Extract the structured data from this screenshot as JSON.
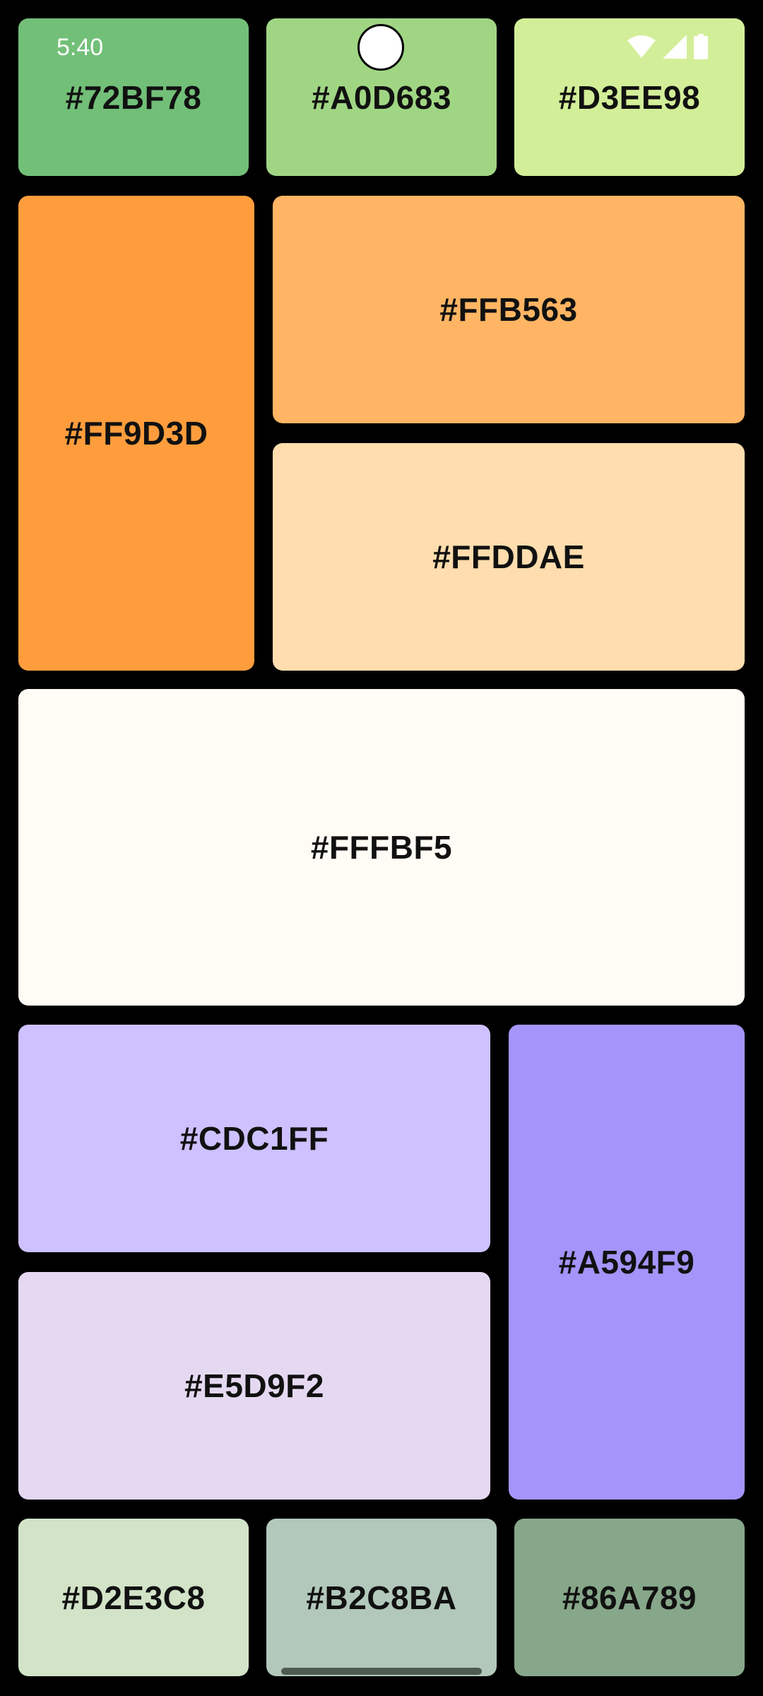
{
  "status_bar": {
    "time": "5:40",
    "icons": [
      "wifi-icon",
      "cell-signal-icon",
      "battery-icon"
    ]
  },
  "tiles": {
    "green_1": {
      "label": "#72BF78",
      "color": "#72BF78"
    },
    "green_2": {
      "label": "#A0D683",
      "color": "#A0D683"
    },
    "green_3": {
      "label": "#D3EE98",
      "color": "#D3EE98"
    },
    "orange_1": {
      "label": "#FF9D3D",
      "color": "#FF9D3D"
    },
    "orange_2": {
      "label": "#FFB563",
      "color": "#FFB563"
    },
    "orange_3": {
      "label": "#FFDDAE",
      "color": "#FFDDAE"
    },
    "cream": {
      "label": "#FFFBF5",
      "color": "#FFFBF5"
    },
    "lavender_1": {
      "label": "#CDC1FF",
      "color": "#CDC1FF"
    },
    "lavender_2": {
      "label": "#E5D9F2",
      "color": "#E5D9F2"
    },
    "purple": {
      "label": "#A594F9",
      "color": "#A594F9"
    },
    "sage_1": {
      "label": "#D2E3C8",
      "color": "#D2E3C8"
    },
    "sage_2": {
      "label": "#B2C8BA",
      "color": "#B2C8BA"
    },
    "sage_3": {
      "label": "#86A789",
      "color": "#86A789"
    }
  }
}
